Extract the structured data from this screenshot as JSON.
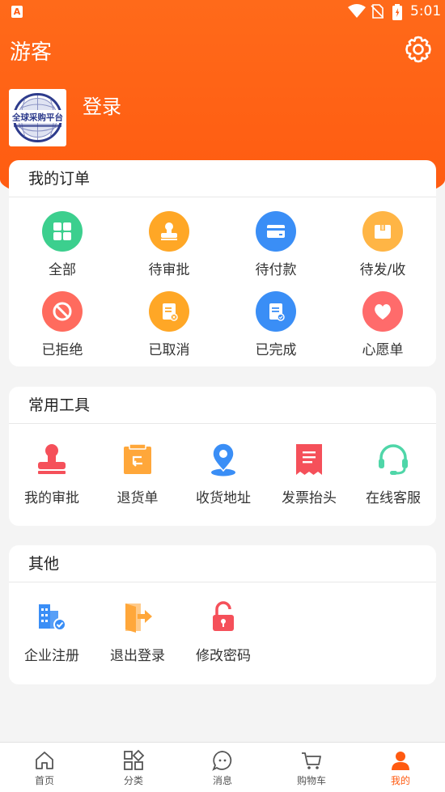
{
  "statusbar": {
    "time": "5:01"
  },
  "header": {
    "title": "游客",
    "login_label": "登录",
    "logo_text": "全球采购平台"
  },
  "orders": {
    "title": "我的订单",
    "items": [
      {
        "label": "全部",
        "icon": "grid-icon",
        "color": "#3ccf8e"
      },
      {
        "label": "待审批",
        "icon": "stamp-icon",
        "color": "#ffa726"
      },
      {
        "label": "待付款",
        "icon": "card-icon",
        "color": "#3a8ef6"
      },
      {
        "label": "待发/收",
        "icon": "box-icon",
        "color": "#ffb545"
      },
      {
        "label": "已拒绝",
        "icon": "prohibit-icon",
        "color": "#ff6b5e"
      },
      {
        "label": "已取消",
        "icon": "doc-cancel-icon",
        "color": "#ffa726"
      },
      {
        "label": "已完成",
        "icon": "doc-check-icon",
        "color": "#3a8ef6"
      },
      {
        "label": "心愿单",
        "icon": "heart-icon",
        "color": "#ff6b6b"
      }
    ]
  },
  "tools": {
    "title": "常用工具",
    "items": [
      {
        "label": "我的审批",
        "icon": "stamp-icon",
        "color": "#f5505a"
      },
      {
        "label": "退货单",
        "icon": "return-doc-icon",
        "color": "#ffa73a"
      },
      {
        "label": "收货地址",
        "icon": "location-icon",
        "color": "#3a8ef6"
      },
      {
        "label": "发票抬头",
        "icon": "invoice-icon",
        "color": "#f5505a"
      },
      {
        "label": "在线客服",
        "icon": "headset-icon",
        "color": "#4fd6a8"
      }
    ]
  },
  "other": {
    "title": "其他",
    "items": [
      {
        "label": "企业注册",
        "icon": "building-check-icon",
        "color": "#3a8ef6"
      },
      {
        "label": "退出登录",
        "icon": "logout-icon",
        "color": "#ffa73a"
      },
      {
        "label": "修改密码",
        "icon": "lock-icon",
        "color": "#f5505a"
      }
    ]
  },
  "tabbar": {
    "active": "我的",
    "accent": "#ff5a10",
    "items": [
      {
        "label": "首页",
        "icon": "home-icon"
      },
      {
        "label": "分类",
        "icon": "category-icon"
      },
      {
        "label": "消息",
        "icon": "message-icon"
      },
      {
        "label": "购物车",
        "icon": "cart-icon"
      },
      {
        "label": "我的",
        "icon": "profile-icon"
      }
    ]
  }
}
